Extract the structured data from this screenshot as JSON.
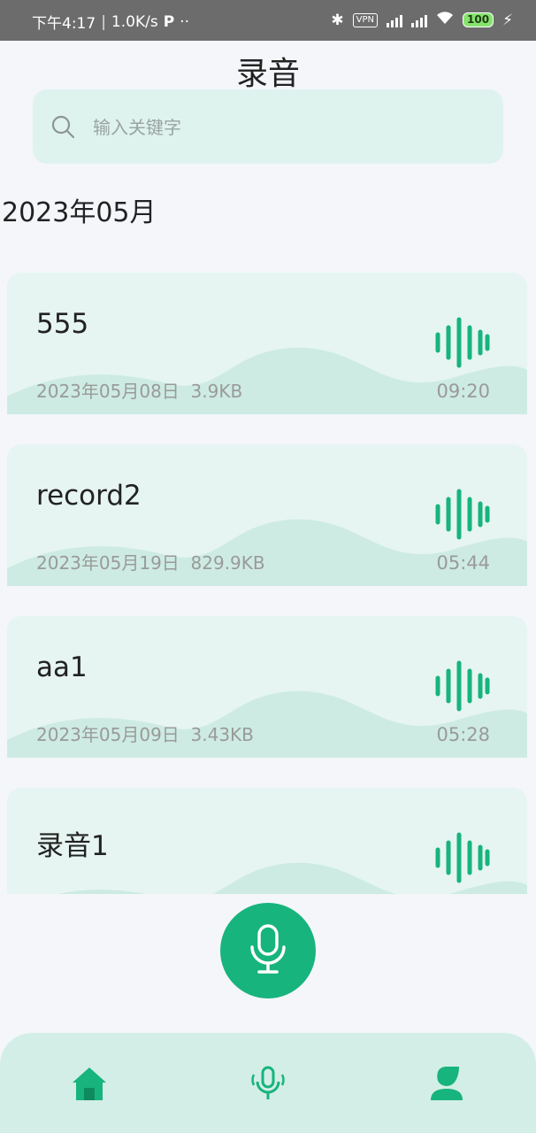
{
  "status_bar": {
    "time": "下午4:17",
    "speed": "1.0K/s",
    "vpn": "VPN",
    "battery": "100"
  },
  "header": {
    "title": "录音"
  },
  "search": {
    "placeholder": "输入关键字",
    "value": ""
  },
  "month_header": "2023年05月",
  "recordings": [
    {
      "name": "555",
      "date": "2023年05月08日",
      "size": "3.9KB",
      "duration": "09:20"
    },
    {
      "name": "record2",
      "date": "2023年05月19日",
      "size": "829.9KB",
      "duration": "05:44"
    },
    {
      "name": "aa1",
      "date": "2023年05月09日",
      "size": "3.43KB",
      "duration": "05:28"
    },
    {
      "name": "录音1",
      "date": "",
      "size": "",
      "duration": ""
    }
  ],
  "colors": {
    "accent": "#17b47d",
    "card": "#e6f5f1",
    "nav": "#d3eee6"
  },
  "nav": [
    {
      "icon": "home-icon"
    },
    {
      "icon": "voice-mic-icon"
    },
    {
      "icon": "user-icon"
    }
  ]
}
